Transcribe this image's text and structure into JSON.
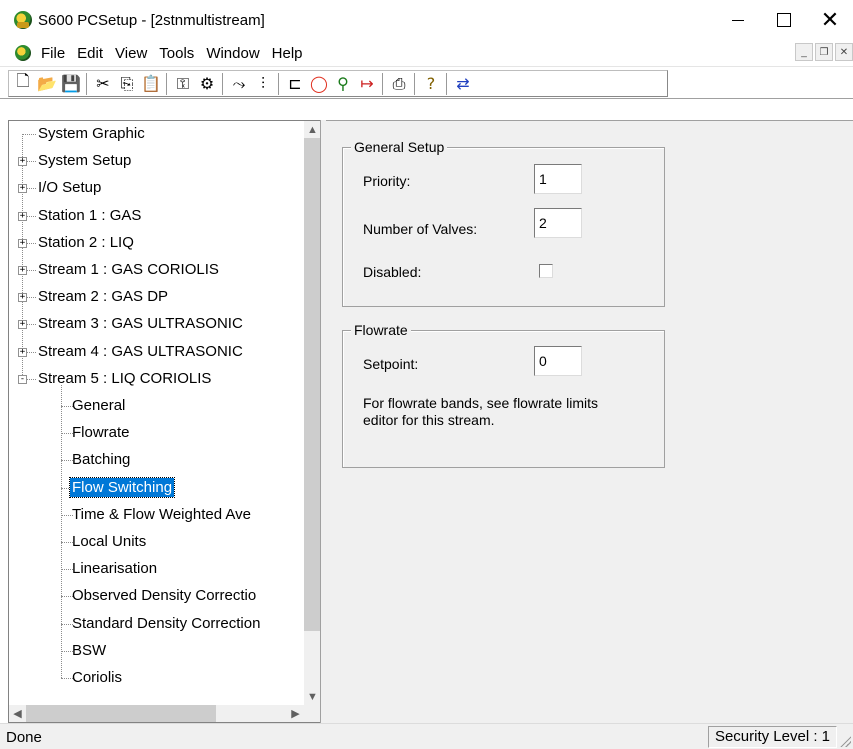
{
  "window": {
    "title": "S600 PCSetup  - [2stnmultistream]"
  },
  "menubar": {
    "items": [
      "File",
      "Edit",
      "View",
      "Tools",
      "Window",
      "Help"
    ]
  },
  "toolbar": {
    "buttons": [
      {
        "name": "new-icon",
        "glyph": "🗋"
      },
      {
        "name": "open-icon",
        "glyph": "📂"
      },
      {
        "name": "save-icon",
        "glyph": "💾"
      },
      {
        "name": "cut-icon",
        "glyph": "✂"
      },
      {
        "name": "copy-icon",
        "glyph": "⎘"
      },
      {
        "name": "paste-icon",
        "glyph": "📋"
      },
      {
        "name": "key-icon",
        "glyph": "⚿"
      },
      {
        "name": "find-icon",
        "glyph": "⚙"
      },
      {
        "name": "network-icon",
        "glyph": "⤳"
      },
      {
        "name": "levels-icon",
        "glyph": "⫶"
      },
      {
        "name": "module-icon",
        "glyph": "⊏"
      },
      {
        "name": "ring-icon",
        "glyph": "◯"
      },
      {
        "name": "plug-icon",
        "glyph": "⚲"
      },
      {
        "name": "connect-icon",
        "glyph": "↦"
      },
      {
        "name": "print-icon",
        "glyph": "⎙"
      },
      {
        "name": "help-icon",
        "glyph": "?"
      },
      {
        "name": "transfer-icon",
        "glyph": "⇄"
      }
    ]
  },
  "tree": {
    "nodes": [
      {
        "label": "System Graphic",
        "level": 0,
        "expander": ""
      },
      {
        "label": "System Setup",
        "level": 0,
        "expander": "+"
      },
      {
        "label": "I/O Setup",
        "level": 0,
        "expander": "+"
      },
      {
        "label": "Station 1 : GAS",
        "level": 0,
        "expander": "+"
      },
      {
        "label": "Station 2 : LIQ",
        "level": 0,
        "expander": "+"
      },
      {
        "label": "Stream 1 : GAS CORIOLIS",
        "level": 0,
        "expander": "+"
      },
      {
        "label": "Stream 2 : GAS DP",
        "level": 0,
        "expander": "+"
      },
      {
        "label": "Stream 3 : GAS ULTRASONIC",
        "level": 0,
        "expander": "+"
      },
      {
        "label": "Stream 4 : GAS ULTRASONIC",
        "level": 0,
        "expander": "+"
      },
      {
        "label": "Stream 5 : LIQ CORIOLIS",
        "level": 0,
        "expander": "−"
      },
      {
        "label": "General",
        "level": 1,
        "expander": ""
      },
      {
        "label": "Flowrate",
        "level": 1,
        "expander": ""
      },
      {
        "label": "Batching",
        "level": 1,
        "expander": ""
      },
      {
        "label": "Flow Switching",
        "level": 1,
        "expander": "",
        "selected": true
      },
      {
        "label": "Time & Flow Weighted Ave",
        "level": 1,
        "expander": ""
      },
      {
        "label": "Local Units",
        "level": 1,
        "expander": ""
      },
      {
        "label": "Linearisation",
        "level": 1,
        "expander": ""
      },
      {
        "label": "Observed Density Correctio",
        "level": 1,
        "expander": ""
      },
      {
        "label": "Standard Density Correction",
        "level": 1,
        "expander": ""
      },
      {
        "label": "BSW",
        "level": 1,
        "expander": ""
      },
      {
        "label": "Coriolis",
        "level": 1,
        "expander": ""
      }
    ]
  },
  "general_setup": {
    "legend": "General Setup",
    "priority_label": "Priority:",
    "priority_value": "1",
    "valves_label": "Number of Valves:",
    "valves_value": "2",
    "disabled_label": "Disabled:",
    "disabled_checked": false
  },
  "flowrate": {
    "legend": "Flowrate",
    "setpoint_label": "Setpoint:",
    "setpoint_value": "0",
    "note_line1": "For flowrate bands, see flowrate limits",
    "note_line2": "editor for this stream."
  },
  "statusbar": {
    "left": "Done",
    "right": "Security Level : 1"
  },
  "colors": {
    "selection": "#0078d7",
    "panel_bg": "#f0f0f0"
  }
}
